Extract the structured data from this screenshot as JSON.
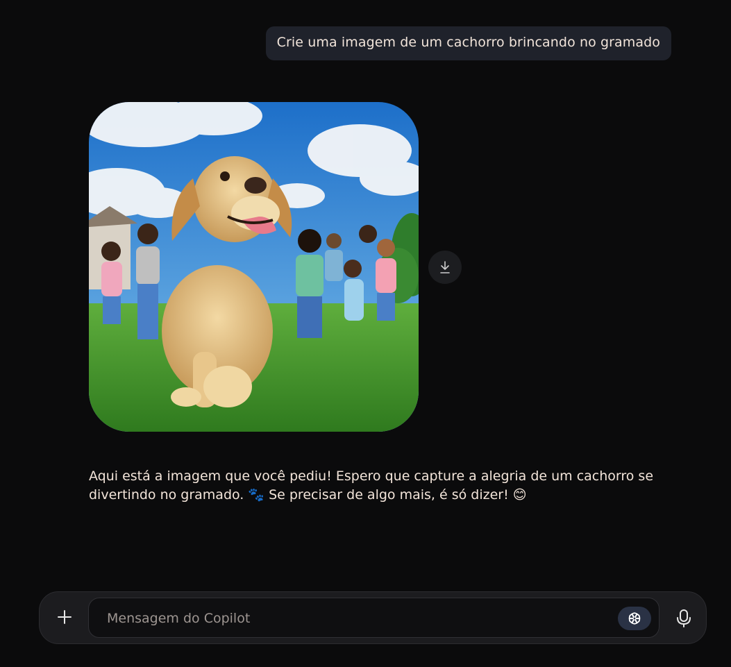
{
  "chat": {
    "user_message": "Crie uma imagem de um cachorro brincando no gramado",
    "assistant_message": "Aqui está a imagem que você pediu! Espero que capture a alegria de um cachorro se divertindo no gramado. 🐾 Se precisar de algo mais, é só dizer! 😊",
    "generated_image": {
      "content": "golden retriever running on grass with children"
    }
  },
  "image_actions": {
    "download_icon": "download-arrow-icon"
  },
  "composer": {
    "placeholder": "Mensagem do Copilot",
    "value": "",
    "add_icon": "plus-icon",
    "mode_icon": "copilot-mode-icon",
    "mic_icon": "microphone-icon"
  },
  "colors": {
    "background": "#0b0b0c",
    "user_bubble": "#1f222b",
    "composer": "#1c1c1f",
    "mode_button": "#2a3245",
    "text": "#f3e5da"
  }
}
